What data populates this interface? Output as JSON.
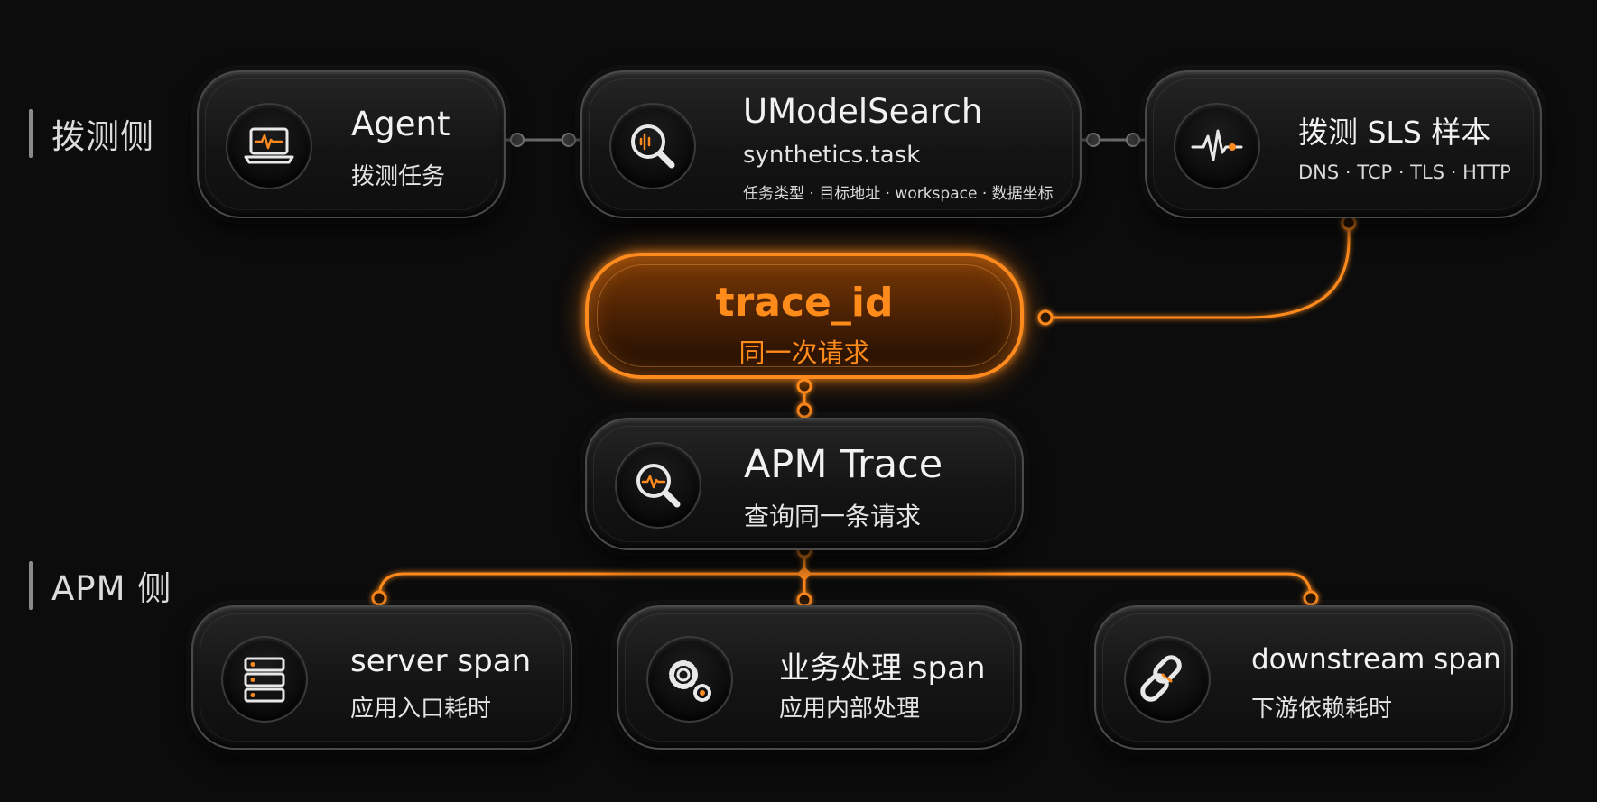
{
  "sections": {
    "synthetic_label": "拨测侧",
    "apm_label": "APM 侧"
  },
  "top_nodes": [
    {
      "title": "Agent",
      "subtitle": "拨测任务",
      "icon": "laptop-pulse-icon"
    },
    {
      "title": "UModelSearch",
      "subtitle": "synthetics.task",
      "detail": "任务类型 · 目标地址 · workspace · 数据坐标",
      "icon": "magnifier-icon"
    },
    {
      "title": "拨测 SLS 样本",
      "subtitle": "DNS · TCP · TLS · HTTP",
      "icon": "waveform-icon"
    }
  ],
  "trace": {
    "title": "trace_id",
    "subtitle": "同一次请求"
  },
  "apm_trace": {
    "title": "APM Trace",
    "subtitle": "查询同一条请求",
    "icon": "magnifier-pulse-icon"
  },
  "spans": [
    {
      "title": "server span",
      "subtitle": "应用入口耗时",
      "icon": "server-icon"
    },
    {
      "title": "业务处理 span",
      "subtitle": "应用内部处理",
      "icon": "gears-icon"
    },
    {
      "title": "downstream span",
      "subtitle": "下游依赖耗时",
      "icon": "chain-link-icon"
    }
  ],
  "colors": {
    "accent": "#ff8a1e",
    "background": "#0c0c0c",
    "card_border": "#4a4a4a",
    "connector_gray": "#6a6a6a"
  }
}
